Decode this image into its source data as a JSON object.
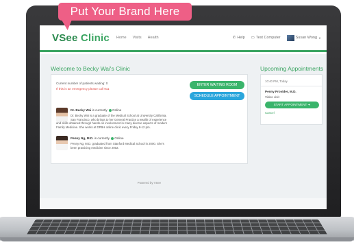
{
  "brand_callout": "Put Your Brand Here",
  "navbar": {
    "logo_prefix": "VSee",
    "logo_suffix": " Clinic",
    "links": [
      "Home",
      "Visits",
      "Health"
    ],
    "help": "Help",
    "help_icon": "phone-icon",
    "test_computer": "Test Computer",
    "test_computer_icon": "monitor-icon",
    "user_name": "Susan Wong"
  },
  "main": {
    "welcome_title": "Welcome to Becky Wai's Clinic",
    "waiting_count_text": "Current number of patients waiting: 0",
    "emergency_text": "If this is an emergency please call 911",
    "enter_waiting_room_label": "ENTER WAITING ROOM",
    "schedule_appointment_label": "SCHEDULE APPOINTMENT",
    "providers": [
      {
        "name": "Dr. Becky Wai",
        "status_prefix": "is currently",
        "status": "Online",
        "bio_lines": [
          "Dr. Becky Wai is a graduate of the Medical School at University California,",
          "San Francisco, who brings to her General Practice a wealth of experience",
          "and skills obtained through hands-on involvement in many diverse aspects of modern",
          "Family Medicine. She works at DPBH online clinic every Friday 8-12 pm."
        ]
      },
      {
        "name": "Penny Ng, M.D.",
        "status_prefix": "is currently",
        "status": "Online",
        "bio_lines": [
          "Penny Ng, M.D. graduated from Stanford Medical School in 2000. She's",
          "been practicing medicine since 2002."
        ]
      }
    ],
    "powered_by": "Powered by VSee"
  },
  "appointments": {
    "title": "Upcoming Appointments",
    "time": "10:40 PM, Today",
    "provider": "Penny Provider, M.D.",
    "type": "Video visit",
    "start_label": "START APPOINTMENT",
    "cancel_label": "Cancel"
  },
  "colors": {
    "brand_green": "#3aa461",
    "button_green": "#3ab46b",
    "button_blue": "#2aa6dc",
    "emergency_red": "#e04b45",
    "callout_pink": "#ee5f86"
  }
}
